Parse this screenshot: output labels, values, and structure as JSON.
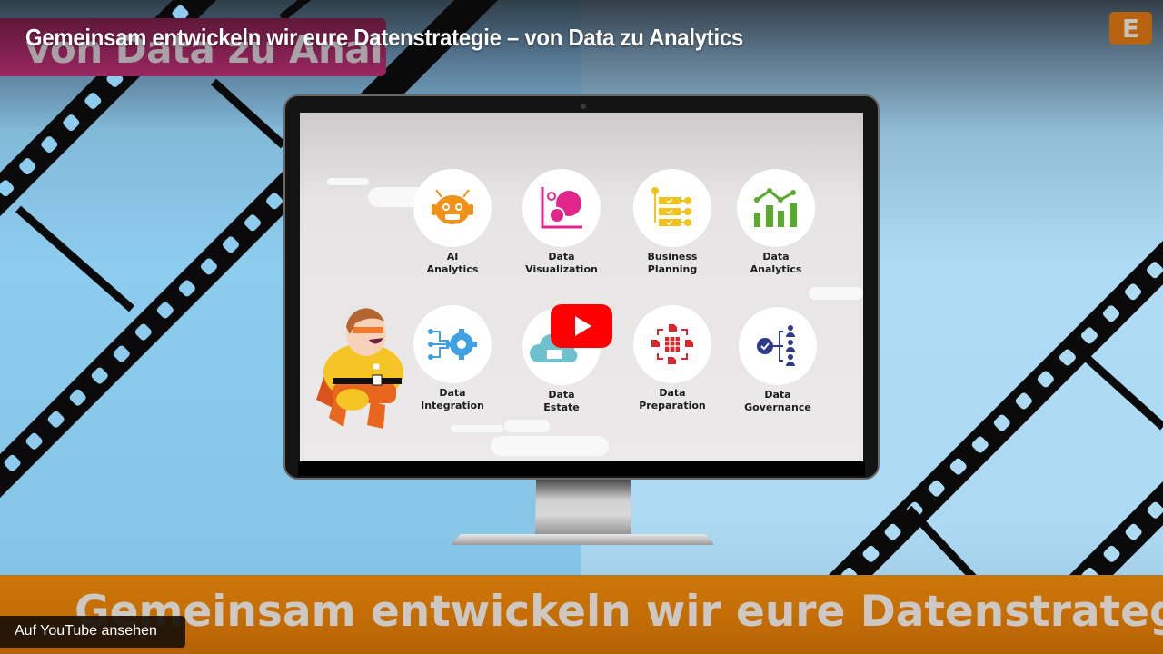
{
  "video": {
    "title": "Gemeinsam entwickeln wir eure Datenstrategie – von Data zu Analytics",
    "channel_logo_letter": "E",
    "play_button_label": "Play",
    "watch_on_youtube": "Auf YouTube ansehen"
  },
  "thumbnail": {
    "top_tag_text": "von Data zu Analytics",
    "bottom_banner_text": "Gemeinsam entwickeln wir eure Datenstrategie",
    "tiles": [
      {
        "line1": "AI",
        "line2": "Analytics",
        "icon": "robot-icon",
        "color": "#f0921a"
      },
      {
        "line1": "Data",
        "line2": "Visualization",
        "icon": "bubble-chart-icon",
        "color": "#e0268a"
      },
      {
        "line1": "Business",
        "line2": "Planning",
        "icon": "checklist-icon",
        "color": "#f2c318"
      },
      {
        "line1": "Data",
        "line2": "Analytics",
        "icon": "bar-line-chart-icon",
        "color": "#5aab2d"
      },
      {
        "line1": "Data",
        "line2": "Integration",
        "icon": "gear-circuit-icon",
        "color": "#3fa0e3"
      },
      {
        "line1": "Data",
        "line2": "Estate",
        "icon": "cloud-icon",
        "color": "#6ec0cc"
      },
      {
        "line1": "Data",
        "line2": "Preparation",
        "icon": "table-docs-icon",
        "color": "#d8282b"
      },
      {
        "line1": "Data",
        "line2": "Governance",
        "icon": "check-hierarchy-icon",
        "color": "#2e3a8c"
      }
    ]
  },
  "colors": {
    "youtube_red": "#ff0000",
    "banner_orange": "#c56e06",
    "tag_pink": "#9a2660",
    "logo_orange": "#b8630f"
  }
}
